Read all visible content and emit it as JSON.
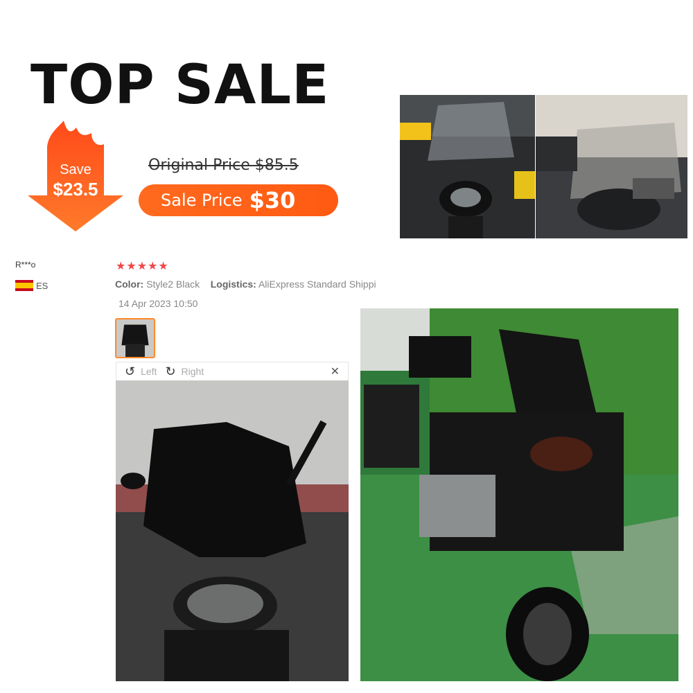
{
  "promo": {
    "title": "TOP SALE",
    "save_label": "Save",
    "save_amount": "$23.5",
    "original_price": "Original Price $85.5",
    "sale_label": "Sale Price",
    "sale_amount": "$30",
    "accent_color": "#ff5a12"
  },
  "review": {
    "reviewer": "R***o",
    "country": "ES",
    "stars": "★★★★★",
    "color_key": "Color:",
    "color_value": "Style2 Black",
    "logistics_key": "Logistics:",
    "logistics_value": "AliExpress Standard Shippi",
    "date": "14 Apr 2023 10:50",
    "rotate_left": "Left",
    "rotate_right": "Right",
    "star_color": "#f04848"
  },
  "icons": [
    "flame-badge-icon",
    "flag-spain-icon",
    "rotate-left-icon",
    "rotate-right-icon",
    "close-icon"
  ]
}
